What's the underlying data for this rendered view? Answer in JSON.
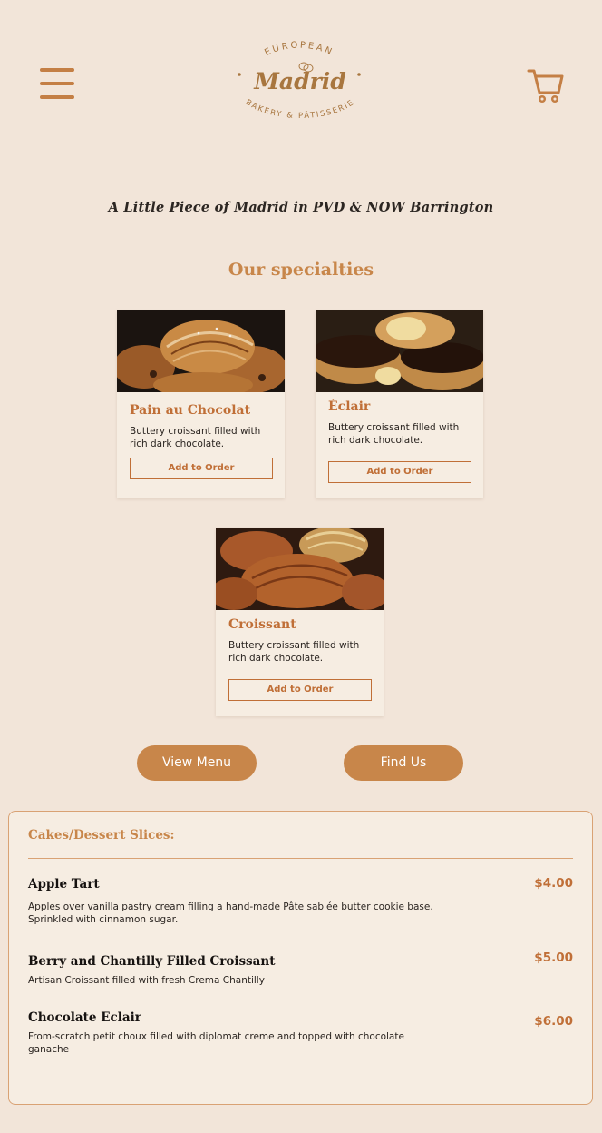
{
  "header": {
    "logo": {
      "top_text": "EUROPEAN",
      "name": "Madrid",
      "bottom_text": "BAKERY & PÂTISSERIE"
    },
    "menu_icon": "hamburger-menu-icon",
    "cart_icon": "shopping-cart-icon"
  },
  "tagline": "A Little Piece of Madrid in PVD & NOW Barrington",
  "specialties": {
    "title": "Our specialties",
    "cards": [
      {
        "title": "Pain au Chocolat",
        "description": "Buttery croissant filled with rich dark chocolate.",
        "button": "Add to Order"
      },
      {
        "title": "Éclair",
        "description": "Buttery croissant filled with rich dark chocolate.",
        "button": "Add to Order"
      },
      {
        "title": "Croissant",
        "description": "Buttery croissant filled with rich dark chocolate.",
        "button": "Add to Order"
      }
    ]
  },
  "actions": {
    "view_menu": "View Menu",
    "find_us": "Find Us"
  },
  "menu": {
    "heading": "Cakes/Dessert Slices:",
    "items": [
      {
        "name": "Apple Tart",
        "price": "$4.00",
        "description": "Apples over vanilla pastry cream filling a hand-made Pâte sablée butter cookie base. Sprinkled with cinnamon sugar."
      },
      {
        "name": "Berry and Chantilly Filled Croissant",
        "price": "$5.00",
        "description": "Artisan Croissant filled with fresh Crema Chantilly"
      },
      {
        "name": "Chocolate Eclair",
        "price": "$6.00",
        "description": "From-scratch petit choux filled with diplomat creme and topped with chocolate ganache"
      }
    ]
  },
  "colors": {
    "background": "#f2e5d9",
    "accent": "#c8864a",
    "accent_dark": "#c06f37",
    "card": "#f6ede2"
  }
}
